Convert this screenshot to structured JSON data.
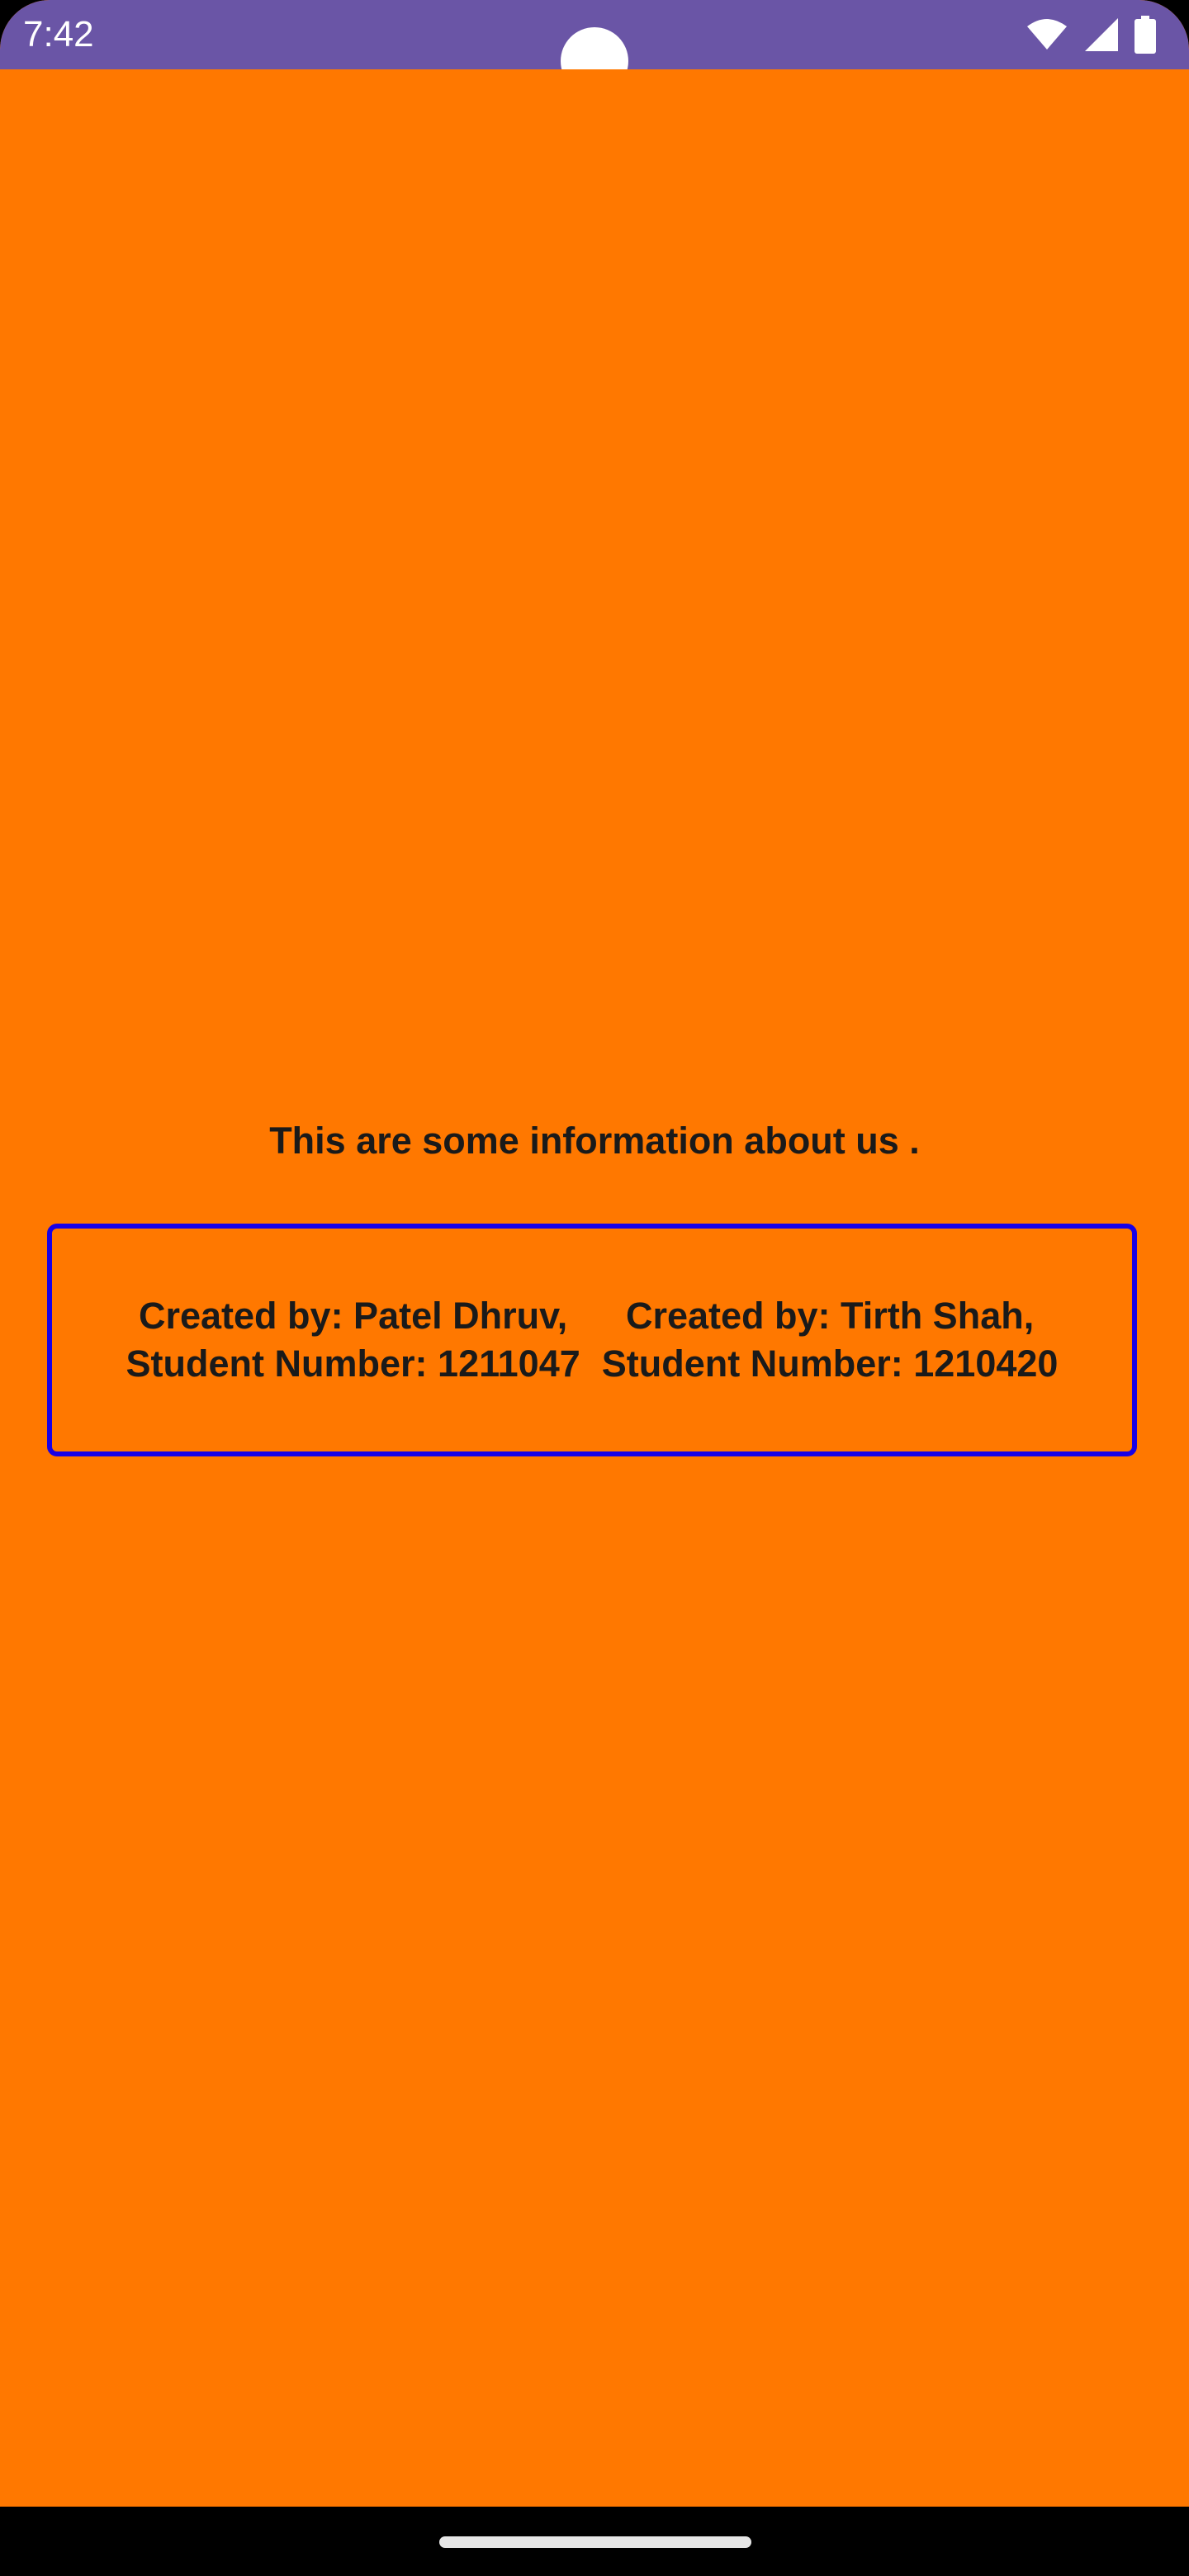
{
  "status_bar": {
    "time": "7:42",
    "icons": [
      "wifi-icon",
      "cellular-signal-icon",
      "battery-icon"
    ],
    "background_color": "#6A55A6"
  },
  "main": {
    "background_color": "#FF7800",
    "heading": "This are some information about us .",
    "info_box": {
      "border_color": "#1800E6",
      "creators": [
        {
          "name_line": "Created by: Patel Dhruv,",
          "student_line": "Student Number: 1211047"
        },
        {
          "name_line": "Created by: Tirth Shah,",
          "student_line": "Student Number: 1210420"
        }
      ]
    }
  },
  "nav_bar": {
    "home_indicator": "home-gesture-pill"
  }
}
